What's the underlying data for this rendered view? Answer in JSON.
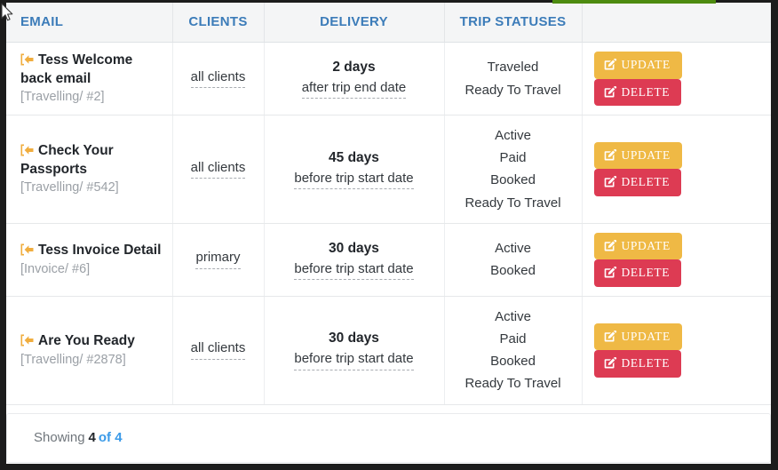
{
  "table": {
    "columns": [
      {
        "key": "email",
        "label": "EMAIL"
      },
      {
        "key": "clients",
        "label": "CLIENTS"
      },
      {
        "key": "delivery",
        "label": "DELIVERY"
      },
      {
        "key": "statuses",
        "label": "TRIP STATUSES"
      },
      {
        "key": "actions",
        "label": ""
      }
    ],
    "rows": [
      {
        "icon": "arrow-left-into-bracket-icon",
        "email_title": "Tess Welcome back email",
        "email_ref": "[Travelling/ #2]",
        "clients": "all clients",
        "delivery_amount": "2 days",
        "delivery_when": "after trip end date",
        "statuses": [
          "Traveled",
          "Ready To Travel"
        ],
        "update_label": "UPDATE",
        "delete_label": "DELETE"
      },
      {
        "icon": "arrow-left-into-bracket-icon",
        "email_title": "Check Your Passports",
        "email_ref": "[Travelling/ #542]",
        "clients": "all clients",
        "delivery_amount": "45 days",
        "delivery_when": "before trip start date",
        "statuses": [
          "Active",
          "Paid",
          "Booked",
          "Ready To Travel"
        ],
        "update_label": "UPDATE",
        "delete_label": "DELETE"
      },
      {
        "icon": "arrow-left-into-bracket-icon",
        "email_title": "Tess Invoice Detail",
        "email_ref": "[Invoice/ #6]",
        "clients": "primary",
        "delivery_amount": "30 days",
        "delivery_when": "before trip start date",
        "statuses": [
          "Active",
          "Booked"
        ],
        "update_label": "UPDATE",
        "delete_label": "DELETE"
      },
      {
        "icon": "arrow-left-into-bracket-icon",
        "email_title": "Are You Ready",
        "email_ref": "[Travelling/ #2878]",
        "clients": "all clients",
        "delivery_amount": "30 days",
        "delivery_when": "before trip start date",
        "statuses": [
          "Active",
          "Paid",
          "Booked",
          "Ready To Travel"
        ],
        "update_label": "UPDATE",
        "delete_label": "DELETE"
      }
    ]
  },
  "footer": {
    "showing_label": "Showing",
    "shown_count": "4",
    "of_total": "of 4"
  },
  "colors": {
    "header_text": "#3c7cb9",
    "update_button": "#efb945",
    "delete_button": "#dd3b53",
    "email_icon": "#f0ad3e",
    "link_blue": "#3a9ae8",
    "top_accent_green": "#4d8b10"
  },
  "top_accent": {
    "name": "progress-accent-bar"
  }
}
